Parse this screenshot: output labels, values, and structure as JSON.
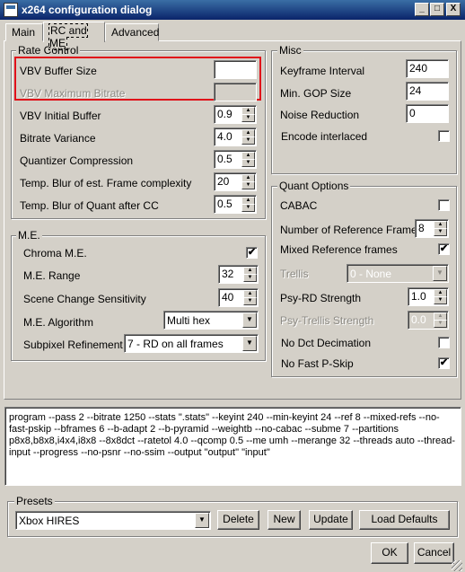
{
  "window": {
    "title": "x264 configuration dialog",
    "buttons": [
      "_",
      "□",
      "X"
    ]
  },
  "tabs": [
    {
      "label": "Main"
    },
    {
      "label": "RC and ME"
    },
    {
      "label": "Advanced"
    }
  ],
  "rate_control": {
    "title": "Rate Control",
    "vbv_buffer_size": {
      "label": "VBV Buffer Size",
      "value": ""
    },
    "vbv_max_bitrate": {
      "label": "VBV Maximum Bitrate",
      "value": ""
    },
    "vbv_initial_buffer": {
      "label": "VBV Initial Buffer",
      "value": "0.9"
    },
    "bitrate_variance": {
      "label": "Bitrate Variance",
      "value": "4.0"
    },
    "quantizer_compression": {
      "label": "Quantizer Compression",
      "value": "0.5"
    },
    "temp_blur_complexity": {
      "label": "Temp. Blur of est. Frame complexity",
      "value": "20"
    },
    "temp_blur_quant": {
      "label": "Temp. Blur of Quant after CC",
      "value": "0.5"
    }
  },
  "me": {
    "title": "M.E.",
    "chroma_me": {
      "label": "Chroma M.E.",
      "checked": "✔"
    },
    "me_range": {
      "label": "M.E. Range",
      "value": "32"
    },
    "scene_change": {
      "label": "Scene Change Sensitivity",
      "value": "40"
    },
    "me_algorithm": {
      "label": "M.E. Algorithm",
      "value": "Multi hex"
    },
    "subpixel": {
      "label": "Subpixel Refinement",
      "value": "7 - RD on all frames"
    }
  },
  "misc": {
    "title": "Misc",
    "keyframe_interval": {
      "label": "Keyframe Interval",
      "value": "240"
    },
    "min_gop": {
      "label": "Min. GOP Size",
      "value": "24"
    },
    "noise_reduction": {
      "label": "Noise Reduction",
      "value": "0"
    },
    "encode_interlaced": {
      "label": "Encode interlaced",
      "checked": ""
    }
  },
  "quant": {
    "title": "Quant Options",
    "cabac": {
      "label": "CABAC",
      "checked": ""
    },
    "ref_frames": {
      "label": "Number of Reference Frames",
      "value": "8"
    },
    "mixed_refs": {
      "label": "Mixed Reference frames",
      "checked": "✔"
    },
    "trellis": {
      "label": "Trellis",
      "value": "0 - None"
    },
    "psy_rd": {
      "label": "Psy-RD Strength",
      "value": "1.0"
    },
    "psy_trellis": {
      "label": "Psy-Trellis Strength",
      "value": "0.0"
    },
    "no_dct_decimation": {
      "label": "No Dct Decimation",
      "checked": ""
    },
    "no_fast_pskip": {
      "label": "No Fast P-Skip",
      "checked": "✔"
    }
  },
  "commandline": "program --pass 2 --bitrate 1250 --stats \".stats\" --keyint 240 --min-keyint 24 --ref 8 --mixed-refs --no-fast-pskip --bframes 6 --b-adapt 2 --b-pyramid --weightb --no-cabac --subme 7 --partitions p8x8,b8x8,i4x4,i8x8 --8x8dct --ratetol 4.0 --qcomp 0.5 --me umh --merange 32 --threads auto --thread-input --progress --no-psnr --no-ssim --output \"output\" \"input\"",
  "presets": {
    "title": "Presets",
    "selected": "Xbox HIRES",
    "delete": "Delete",
    "new": "New",
    "update": "Update",
    "load_defaults": "Load Defaults"
  },
  "footer": {
    "ok": "OK",
    "cancel": "Cancel"
  },
  "colors": {
    "highlight_box": "#e0101a",
    "title_bar": "#0a246a",
    "face": "#d4d0c8"
  }
}
